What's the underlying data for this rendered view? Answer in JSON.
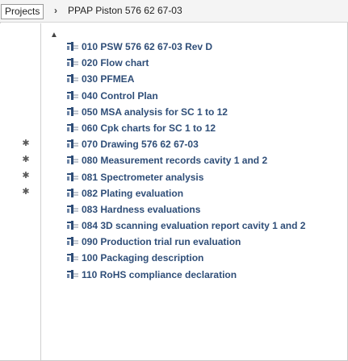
{
  "breadcrumb": {
    "root": "Projects",
    "separator": "›",
    "current": "PPAP Piston 576 62 67-03"
  },
  "icons": {
    "pin": "pin-icon",
    "scroll_up": "chevron-up-icon",
    "document": "document-icon"
  },
  "colors": {
    "item_text": "#2f4e78",
    "icon_accent": "#c0c6cf"
  },
  "items": [
    {
      "label": "010 PSW 576 62 67-03 Rev D"
    },
    {
      "label": "020 Flow chart"
    },
    {
      "label": "030 PFMEA"
    },
    {
      "label": "040 Control Plan"
    },
    {
      "label": "050 MSA analysis for SC 1 to 12"
    },
    {
      "label": "060 Cpk charts for SC 1 to 12"
    },
    {
      "label": "070 Drawing 576 62 67-03"
    },
    {
      "label": "080 Measurement records cavity 1 and 2"
    },
    {
      "label": "081 Spectrometer analysis"
    },
    {
      "label": "082 Plating evaluation"
    },
    {
      "label": "083 Hardness evaluations"
    },
    {
      "label": "084 3D scanning evaluation report cavity 1 and 2"
    },
    {
      "label": "090 Production trial run evaluation"
    },
    {
      "label": "100 Packaging description"
    },
    {
      "label": "110 RoHS compliance declaration"
    }
  ]
}
